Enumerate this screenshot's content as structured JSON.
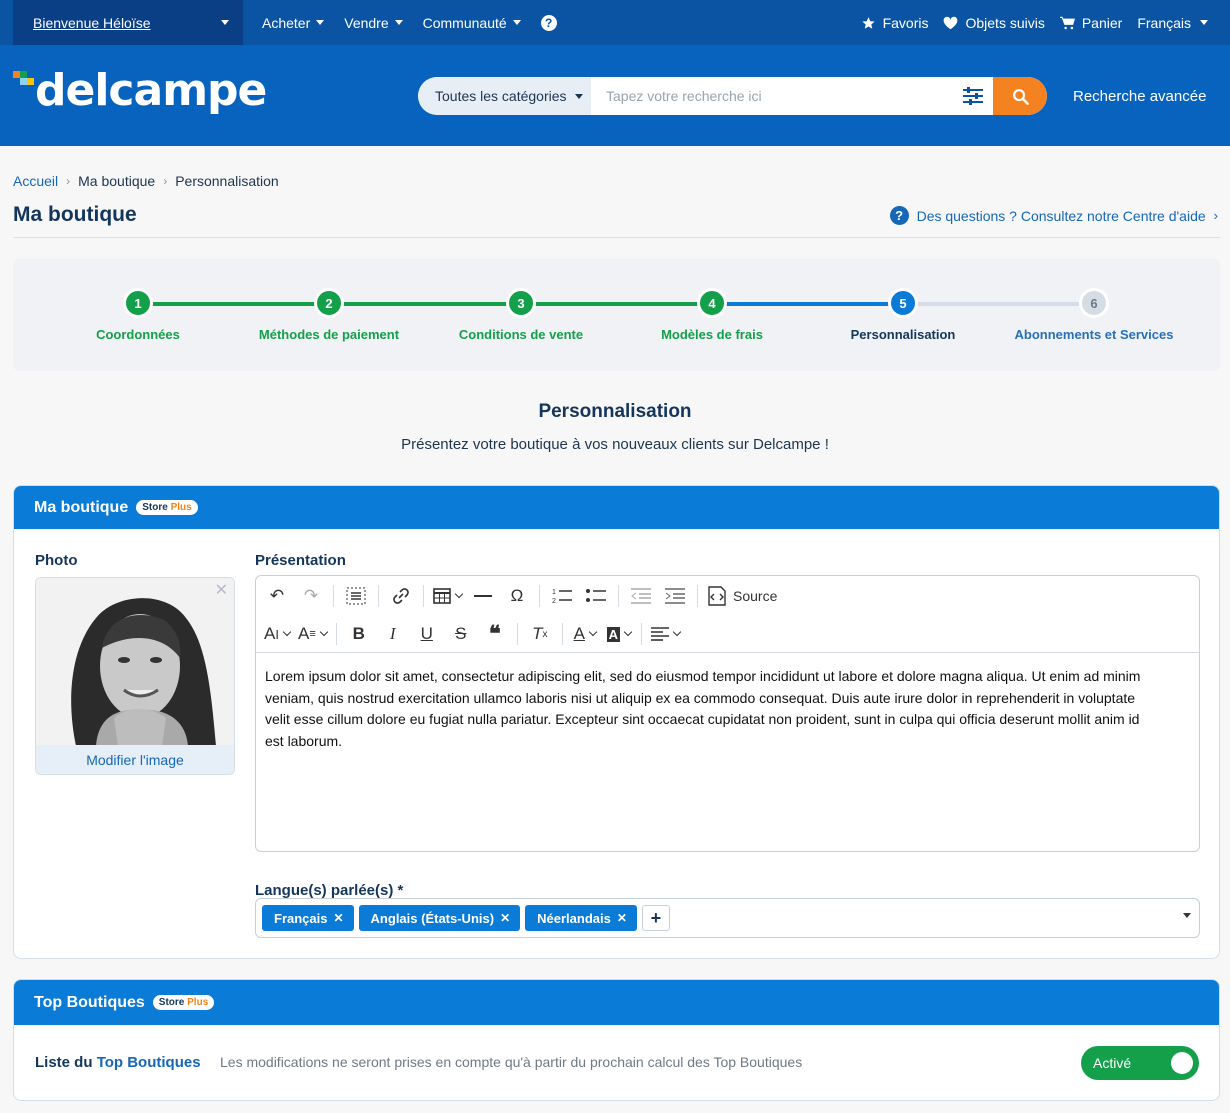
{
  "topbar": {
    "welcome": "Bienvenue Héloïse",
    "nav": [
      {
        "label": "Acheter"
      },
      {
        "label": "Vendre"
      },
      {
        "label": "Communauté"
      }
    ],
    "right": {
      "favorites": "Favoris",
      "watched": "Objets suivis",
      "cart": "Panier",
      "language": "Français"
    }
  },
  "header": {
    "logo_text": "delcampe",
    "search_category": "Toutes les catégories",
    "search_placeholder": "Tapez votre recherche ici",
    "advanced_search": "Recherche avancée"
  },
  "breadcrumb": [
    "Accueil",
    "Ma boutique",
    "Personnalisation"
  ],
  "page_title": "Ma boutique",
  "help_link": "Des questions ? Consultez notre Centre d'aide",
  "stepper": {
    "steps": [
      {
        "num": "1",
        "label": "Coordonnées",
        "state": "done"
      },
      {
        "num": "2",
        "label": "Méthodes de paiement",
        "state": "done"
      },
      {
        "num": "3",
        "label": "Conditions de vente",
        "state": "done"
      },
      {
        "num": "4",
        "label": "Modèles de frais",
        "state": "done"
      },
      {
        "num": "5",
        "label": "Personnalisation",
        "state": "current"
      },
      {
        "num": "6",
        "label": "Abonnements et Services",
        "state": "todo"
      }
    ]
  },
  "section": {
    "title": "Personnalisation",
    "subtitle": "Présentez votre boutique à vos nouveaux clients sur Delcampe !"
  },
  "shop_panel": {
    "title": "Ma boutique",
    "badge_store": "Store",
    "badge_plus": "Plus",
    "photo_label": "Photo",
    "photo_edit": "Modifier l'image",
    "presentation_label": "Présentation",
    "source_label": "Source",
    "presentation_text": "Lorem ipsum dolor sit amet, consectetur adipiscing elit, sed do eiusmod tempor incididunt ut labore et dolore magna aliqua. Ut enim ad minim veniam, quis nostrud exercitation ullamco laboris nisi ut aliquip ex ea commodo consequat. Duis aute irure dolor in reprehenderit in voluptate velit esse cillum dolore eu fugiat nulla pariatur. Excepteur sint occaecat cupidatat non proident, sunt in culpa qui officia deserunt mollit anim id est laborum.",
    "languages_label": "Langue(s) parlée(s) *",
    "languages": [
      "Français",
      "Anglais (États-Unis)",
      "Néerlandais"
    ]
  },
  "top_panel": {
    "title": "Top Boutiques",
    "badge_store": "Store",
    "badge_plus": "Plus",
    "list_label_prefix": "Liste du",
    "list_label_link": "Top Boutiques",
    "note": "Les modifications ne seront prises en compte qu'à partir du prochain calcul des Top Boutiques",
    "toggle_label": "Activé",
    "toggle_on": true
  },
  "colors": {
    "topbar": "#0a54a3",
    "header": "#0763bd",
    "accent": "#0a7bd6",
    "search_button": "#f58220",
    "step_done": "#14a04a",
    "step_current": "#0a7bd6",
    "step_todo": "#d5dce6"
  }
}
